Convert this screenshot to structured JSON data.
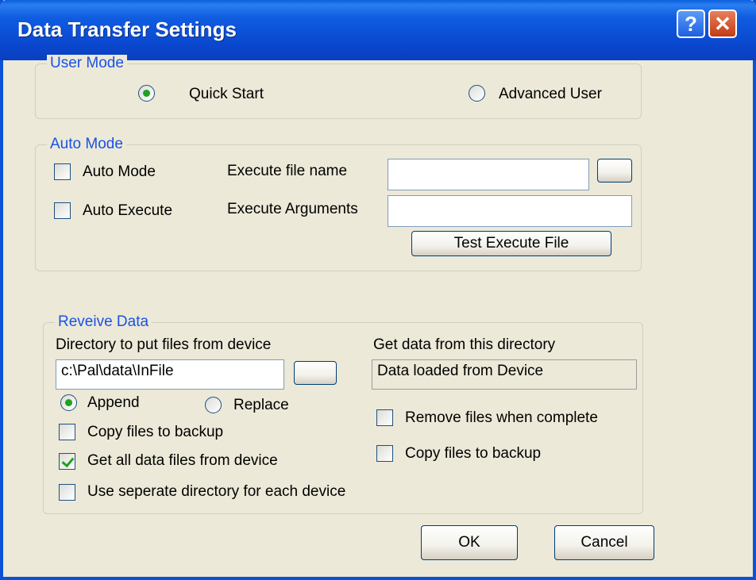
{
  "window": {
    "title": "Data Transfer Settings",
    "help_glyph": "?",
    "close_glyph": "✕"
  },
  "user_mode": {
    "legend": "User Mode",
    "quick_start": {
      "label": "Quick Start",
      "selected": true
    },
    "advanced_user": {
      "label": "Advanced User",
      "selected": false
    }
  },
  "auto_mode": {
    "legend": "Auto Mode",
    "auto_mode_checkbox": {
      "label": "Auto Mode",
      "checked": false
    },
    "auto_execute_checkbox": {
      "label": "Auto Execute",
      "checked": false
    },
    "execute_file_name": {
      "label": "Execute file name",
      "value": ""
    },
    "execute_arguments": {
      "label": "Execute Arguments",
      "value": ""
    },
    "browse_label": "",
    "test_button": "Test Execute File"
  },
  "receive_data": {
    "legend": "Reveive Data",
    "directory_label": "Directory to put files from device",
    "directory_value": "c:\\Pal\\data\\InFile",
    "browse_label": "",
    "append": {
      "label": "Append",
      "selected": true
    },
    "replace": {
      "label": "Replace",
      "selected": false
    },
    "copy_backup_left": {
      "label": "Copy files to backup",
      "checked": false
    },
    "get_all": {
      "label": "Get all data files from device",
      "checked": true
    },
    "separate_dir": {
      "label": "Use seperate directory for each device",
      "checked": false
    },
    "get_from_label": "Get data from this directory",
    "get_from_value": "Data loaded from Device",
    "remove_files": {
      "label": "Remove files when complete",
      "checked": false
    },
    "copy_backup_right": {
      "label": "Copy files to backup",
      "checked": false
    }
  },
  "buttons": {
    "ok": "OK",
    "cancel": "Cancel"
  },
  "colors": {
    "titlebar": "#0a49d0",
    "legend_text": "#1a52e6",
    "dialog_bg": "#ece9d8",
    "check_green": "#21a121"
  }
}
